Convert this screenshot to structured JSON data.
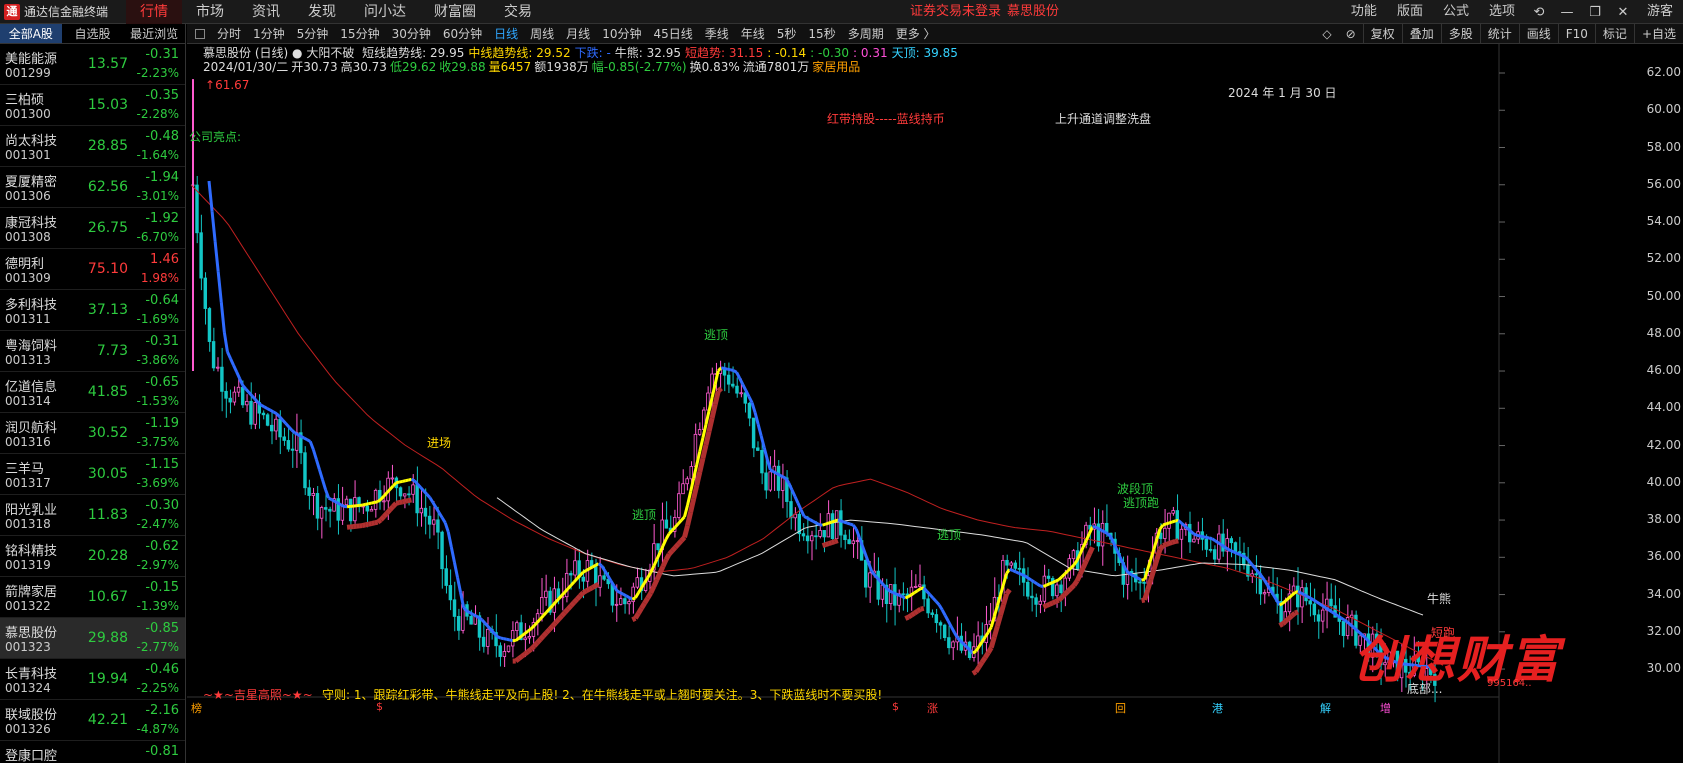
{
  "app": {
    "logo_text": "通达信金融终端",
    "logo_mark": "通"
  },
  "top_nav": [
    "行情",
    "市场",
    "资讯",
    "发现",
    "问小达",
    "财富圈",
    "交易"
  ],
  "notice": {
    "text": "证券交易未登录",
    "stock": "慕思股份"
  },
  "right_nav": [
    "功能",
    "版面",
    "公式",
    "选项"
  ],
  "right_icons": [
    "⟲",
    "—",
    "❐",
    "✕"
  ],
  "user": "游客",
  "left_tabs": [
    "全部A股",
    "自选股",
    "最近浏览"
  ],
  "stocks": [
    {
      "name": "美能能源",
      "code": "001299",
      "price": "13.57",
      "change": "-0.31",
      "pct": "-2.23%",
      "dir": "down"
    },
    {
      "name": "三柏硕",
      "code": "001300",
      "price": "15.03",
      "change": "-0.35",
      "pct": "-2.28%",
      "dir": "down"
    },
    {
      "name": "尚太科技",
      "code": "001301",
      "price": "28.85",
      "change": "-0.48",
      "pct": "-1.64%",
      "dir": "down"
    },
    {
      "name": "夏厦精密",
      "code": "001306",
      "price": "62.56",
      "change": "-1.94",
      "pct": "-3.01%",
      "dir": "down"
    },
    {
      "name": "康冠科技",
      "code": "001308",
      "price": "26.75",
      "change": "-1.92",
      "pct": "-6.70%",
      "dir": "down"
    },
    {
      "name": "德明利",
      "code": "001309",
      "price": "75.10",
      "change": "1.46",
      "pct": "1.98%",
      "dir": "up"
    },
    {
      "name": "多利科技",
      "code": "001311",
      "price": "37.13",
      "change": "-0.64",
      "pct": "-1.69%",
      "dir": "down"
    },
    {
      "name": "粤海饲料",
      "code": "001313",
      "price": "7.73",
      "change": "-0.31",
      "pct": "-3.86%",
      "dir": "down"
    },
    {
      "name": "亿道信息",
      "code": "001314",
      "price": "41.85",
      "change": "-0.65",
      "pct": "-1.53%",
      "dir": "down"
    },
    {
      "name": "润贝航科",
      "code": "001316",
      "price": "30.52",
      "change": "-1.19",
      "pct": "-3.75%",
      "dir": "down"
    },
    {
      "name": "三羊马",
      "code": "001317",
      "price": "30.05",
      "change": "-1.15",
      "pct": "-3.69%",
      "dir": "down"
    },
    {
      "name": "阳光乳业",
      "code": "001318",
      "price": "11.83",
      "change": "-0.30",
      "pct": "-2.47%",
      "dir": "down"
    },
    {
      "name": "铭科精技",
      "code": "001319",
      "price": "20.28",
      "change": "-0.62",
      "pct": "-2.97%",
      "dir": "down"
    },
    {
      "name": "箭牌家居",
      "code": "001322",
      "price": "10.67",
      "change": "-0.15",
      "pct": "-1.39%",
      "dir": "down"
    },
    {
      "name": "慕思股份",
      "code": "001323",
      "price": "29.88",
      "change": "-0.85",
      "pct": "-2.77%",
      "dir": "down",
      "selected": true
    },
    {
      "name": "长青科技",
      "code": "001324",
      "price": "19.94",
      "change": "-0.46",
      "pct": "-2.25%",
      "dir": "down"
    },
    {
      "name": "联域股份",
      "code": "001326",
      "price": "42.21",
      "change": "-2.16",
      "pct": "-4.87%",
      "dir": "down"
    },
    {
      "name": "登康口腔",
      "code": "",
      "price": "",
      "change": "-0.81",
      "pct": "",
      "dir": "down"
    }
  ],
  "periods": [
    "分时",
    "1分钟",
    "5分钟",
    "15分钟",
    "30分钟",
    "60分钟",
    "日线",
    "周线",
    "月线",
    "10分钟",
    "45日线",
    "季线",
    "年线",
    "5秒",
    "15秒",
    "多周期",
    "更多 〉"
  ],
  "active_period": "日线",
  "chart_tools": [
    "复权",
    "叠加",
    "多股",
    "统计",
    "画线",
    "F10",
    "标记",
    "+自选"
  ],
  "chart_info": {
    "title": "慕思股份 (日线)",
    "indicator_name": "大阳不破",
    "line1": [
      {
        "t": "短线趋势线: 29.95",
        "c": "white"
      },
      {
        "t": "中线趋势线: 29.52",
        "c": "yellow"
      },
      {
        "t": "下跌: -",
        "c": "blue"
      },
      {
        "t": "牛熊: 32.95",
        "c": "white"
      },
      {
        "t": "短趋势: 31.15",
        "c": "up"
      },
      {
        "t": ": -0.14",
        "c": "yellow"
      },
      {
        "t": ": -0.30",
        "c": "down"
      },
      {
        "t": ": 0.31",
        "c": "magenta"
      },
      {
        "t": "天顶: 39.85",
        "c": "cyan"
      }
    ],
    "line2": [
      {
        "t": "2024/01/30/二",
        "c": "white"
      },
      {
        "t": "开30.73",
        "c": "white"
      },
      {
        "t": "高30.73",
        "c": "white"
      },
      {
        "t": "低29.62",
        "c": "down"
      },
      {
        "t": "收29.88",
        "c": "down"
      },
      {
        "t": "量6457",
        "c": "yellow"
      },
      {
        "t": "额1938万",
        "c": "white"
      },
      {
        "t": "幅-0.85(-2.77%)",
        "c": "down"
      },
      {
        "t": "换0.83%",
        "c": "white"
      },
      {
        "t": "流通7801万",
        "c": "white"
      },
      {
        "t": "家居用品",
        "c": "orange"
      }
    ]
  },
  "chart_data": {
    "type": "candlestick",
    "title": "慕思股份 (日线)",
    "ylim": [
      28.5,
      62.5
    ],
    "y_ticks": [
      "62.00",
      "60.00",
      "58.00",
      "56.00",
      "54.00",
      "52.00",
      "50.00",
      "48.00",
      "46.00",
      "44.00",
      "42.00",
      "40.00",
      "38.00",
      "36.00",
      "34.00",
      "32.00",
      "30.00"
    ],
    "date_label": "2024 年 1 月 30 日",
    "high_marker": "61.67",
    "last_close": 29.88,
    "trend_price_path": [
      56,
      47,
      45,
      44,
      43.5,
      42.5,
      42,
      39,
      38.5,
      38.6,
      38.8,
      39.8,
      40,
      39,
      37.5,
      33,
      32.5,
      31.5,
      31.3,
      32,
      33,
      34,
      35,
      35.5,
      34,
      33.5,
      35,
      37,
      38,
      42,
      46,
      45.8,
      44,
      40.5,
      40,
      38,
      37.5,
      37.8,
      37.5,
      35,
      34,
      33.6,
      34.2,
      33.2,
      31.5,
      30.6,
      32,
      35.2,
      34.8,
      34.2,
      34.6,
      35.5,
      37.5,
      37,
      35,
      34.5,
      37.5,
      37.8,
      37,
      36.8,
      36.2,
      35.8,
      34.7,
      33.2,
      34,
      33.5,
      32.9,
      32.3,
      31.5,
      30.5,
      30.1,
      30,
      29.9
    ],
    "ma_red_path": [
      56,
      54,
      51,
      48,
      45.5,
      43.5,
      42,
      40.8,
      39.2,
      38,
      37,
      36.2,
      35.6,
      35.2,
      35.4,
      36,
      37,
      38.5,
      39.8,
      40.2,
      39.5,
      38.6,
      38,
      37.6,
      37.4,
      37,
      36.6,
      36.2,
      35.8,
      35.4,
      34.8,
      34,
      33.2,
      32.2,
      31.2,
      30.2
    ],
    "ma_white_path": [
      39.2,
      37.5,
      36.2,
      35.5,
      35,
      35.2,
      36.2,
      37.6,
      38,
      37.8,
      37.5,
      37.2,
      36.8,
      35.4,
      35,
      35.3,
      35.7,
      35.6,
      35.3,
      34.8,
      33.8,
      32.9
    ],
    "legend_labels": [
      "牛熊",
      "短跑"
    ],
    "annotations": [
      {
        "text": "公司亮点:",
        "c": "down"
      },
      {
        "text": "红带持股-----蓝线持币",
        "c": "up"
      },
      {
        "text": "上升通道调整洗盘",
        "c": "white"
      },
      {
        "text": "逃顶",
        "c": "down"
      },
      {
        "text": "逃顶",
        "c": "down"
      },
      {
        "text": "逃顶",
        "c": "down"
      },
      {
        "text": "波段顶",
        "c": "down"
      },
      {
        "text": "逃顶跑",
        "c": "down"
      },
      {
        "text": "进场",
        "c": "yellow"
      }
    ],
    "bottom_rule": "守则: 1、跟踪红彩带、牛熊线走平及向上股! 2、在牛熊线走平或上翘时要关注。3、下跌蓝线时不要买股!",
    "bottom_left": "~★~吉星高照~★~",
    "bottom_markers": [
      "榜",
      "$",
      "$",
      "涨",
      "回",
      "港",
      "解",
      "增"
    ],
    "watermark": "创想财富",
    "watermark_num": "995164..",
    "bottom_tail": "底部..."
  },
  "colors": {
    "up": "#ff3b3b",
    "down": "#2ecc40",
    "trend_up": "#ffff00",
    "trend_down": "#2f6bff",
    "ribbon": "#b03030",
    "ma_red": "#c02020",
    "ma_white": "#dddddd"
  }
}
